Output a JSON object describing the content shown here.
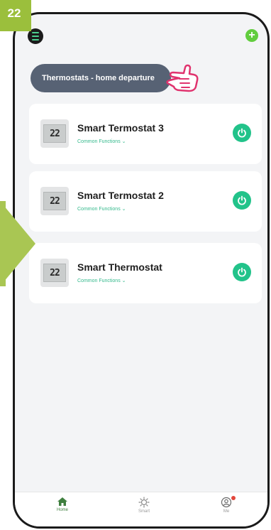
{
  "step": {
    "number": "22"
  },
  "colors": {
    "accent": "#22c38a",
    "badge": "#9bbf3c",
    "pill": "#576274",
    "hand": "#e0336e"
  },
  "header": {
    "menu_icon": "menu-icon",
    "add_icon": "plus-icon"
  },
  "scene": {
    "label": "Thermostats - home departure"
  },
  "devices": [
    {
      "name": "Smart Termostat 3",
      "functions": "Common Functions",
      "display": "22"
    },
    {
      "name": "Smart Termostat 2",
      "functions": "Common Functions",
      "display": "22"
    },
    {
      "name": "Smart Thermostat",
      "functions": "Common Functions",
      "display": "22"
    }
  ],
  "tabs": [
    {
      "label": "Home",
      "icon": "house-icon",
      "active": true
    },
    {
      "label": "Smart",
      "icon": "sun-icon",
      "active": false
    },
    {
      "label": "Me",
      "icon": "profile-icon",
      "active": false
    }
  ]
}
